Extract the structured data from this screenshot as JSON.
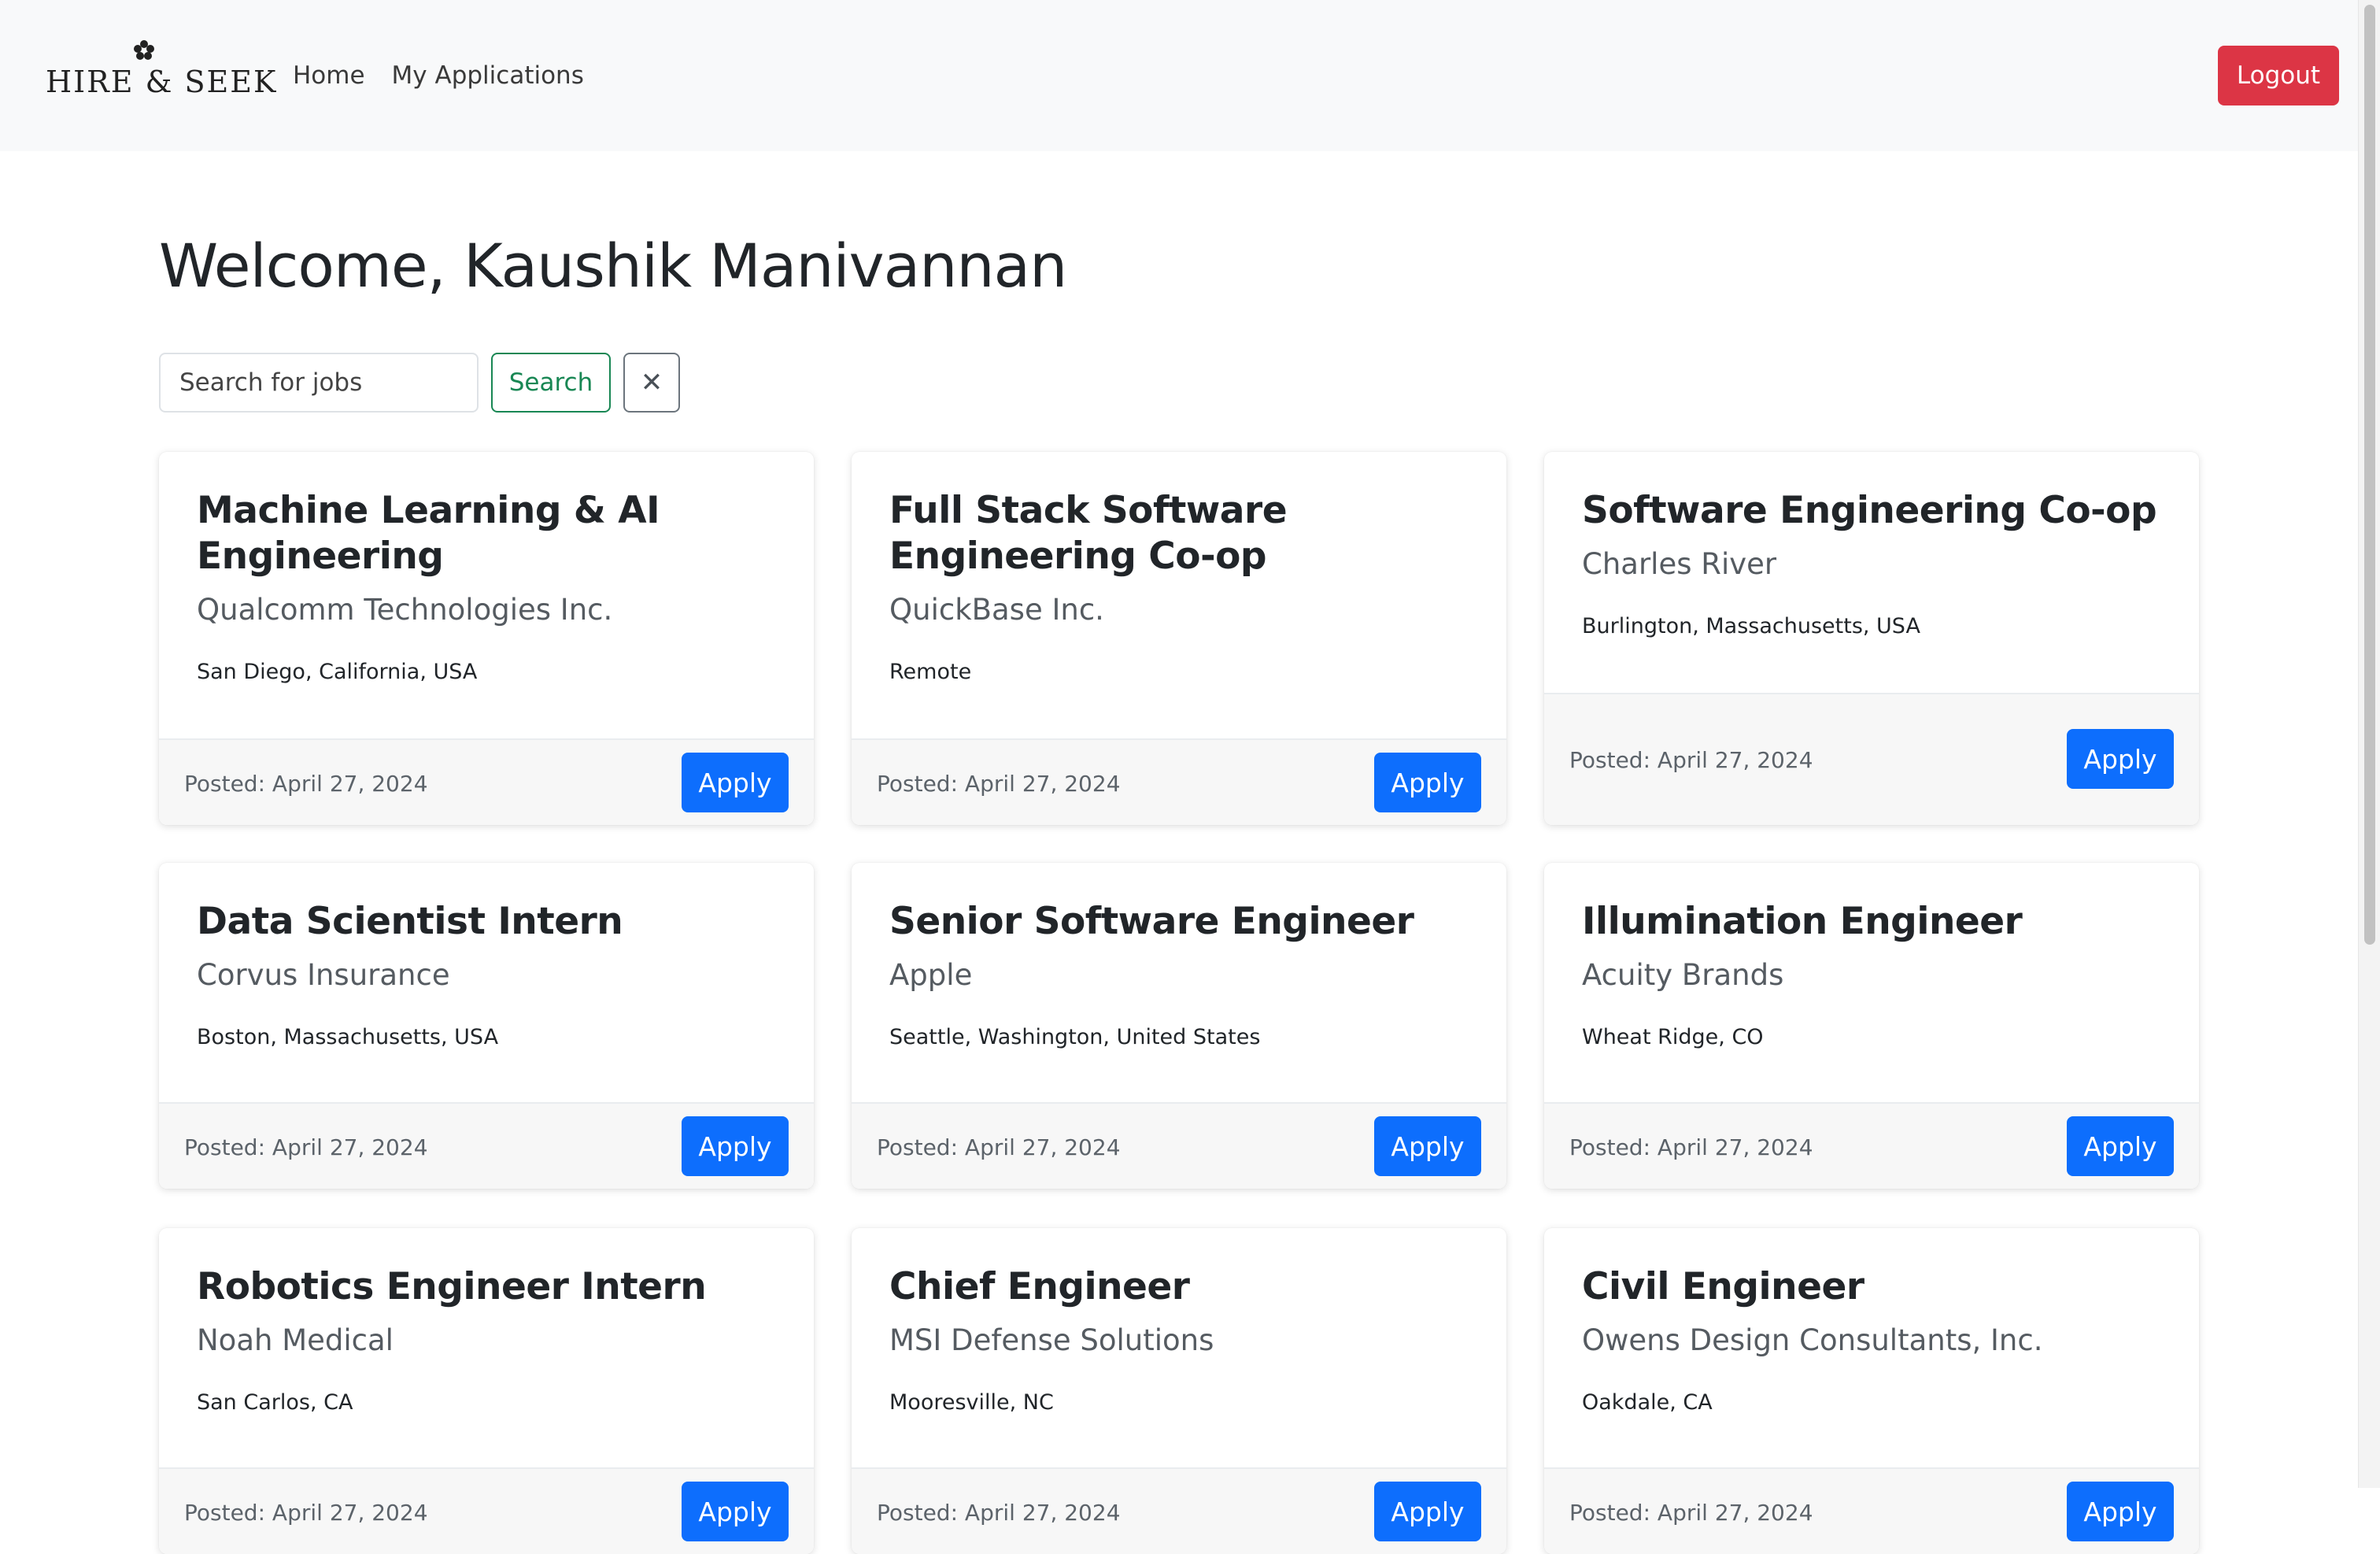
{
  "navbar": {
    "brand_text": "HIRE & SEEK",
    "links": [
      "Home",
      "My Applications"
    ],
    "logout_label": "Logout"
  },
  "welcome": "Welcome, Kaushik Manivannan",
  "search": {
    "placeholder": "Search for jobs",
    "button_label": "Search",
    "clear_label": "✕"
  },
  "colors": {
    "primary": "#0d6efd",
    "danger": "#dc3545",
    "success": "#198754"
  },
  "apply_label": "Apply",
  "jobs": [
    {
      "title": "Machine Learning & AI Engineering",
      "company": "Qualcomm Technologies Inc.",
      "location": "San Diego, California, USA",
      "posted": "Posted: April 27, 2024"
    },
    {
      "title": "Full Stack Software Engineering Co-op",
      "company": "QuickBase Inc.",
      "location": "Remote",
      "posted": "Posted: April 27, 2024"
    },
    {
      "title": "Software Engineering Co-op",
      "company": "Charles River",
      "location": "Burlington, Massachusetts, USA",
      "posted": "Posted: April 27, 2024"
    },
    {
      "title": "Data Scientist Intern",
      "company": "Corvus Insurance",
      "location": "Boston, Massachusetts, USA",
      "posted": "Posted: April 27, 2024"
    },
    {
      "title": "Senior Software Engineer",
      "company": "Apple",
      "location": "Seattle, Washington, United States",
      "posted": "Posted: April 27, 2024"
    },
    {
      "title": "Illumination Engineer",
      "company": "Acuity Brands",
      "location": "Wheat Ridge, CO",
      "posted": "Posted: April 27, 2024"
    },
    {
      "title": "Robotics Engineer Intern",
      "company": "Noah Medical",
      "location": "San Carlos, CA",
      "posted": "Posted: April 27, 2024"
    },
    {
      "title": "Chief Engineer",
      "company": "MSI Defense Solutions",
      "location": "Mooresville, NC",
      "posted": "Posted: April 27, 2024"
    },
    {
      "title": "Civil Engineer",
      "company": "Owens Design Consultants, Inc.",
      "location": "Oakdale, CA",
      "posted": "Posted: April 27, 2024"
    }
  ]
}
